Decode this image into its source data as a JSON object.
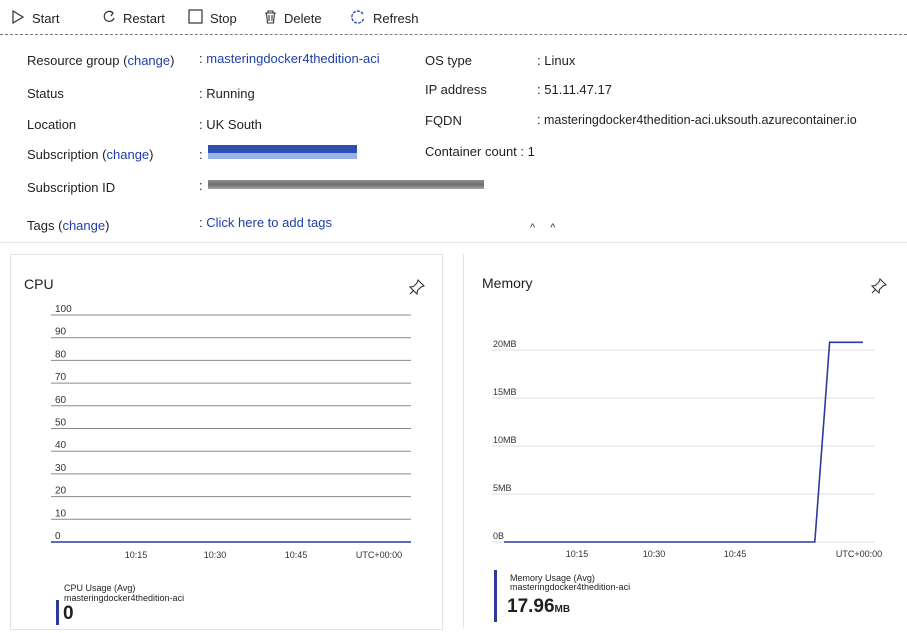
{
  "toolbar": {
    "start": "Start",
    "restart": "Restart",
    "stop": "Stop",
    "delete": "Delete",
    "refresh": "Refresh"
  },
  "essentials": {
    "resource_group_label": "Resource group",
    "change": "change",
    "resource_group_value": "masteringdocker4thedition-aci",
    "status_label": "Status",
    "status_value": "Running",
    "location_label": "Location",
    "location_value": "UK South",
    "subscription_label": "Subscription",
    "subscription_id_label": "Subscription ID",
    "tags_label": "Tags",
    "tags_value": "Click here to add tags",
    "os_type_label": "OS type",
    "os_type_value": "Linux",
    "ip_label": "IP address",
    "ip_value": "51.11.47.17",
    "fqdn_label": "FQDN",
    "fqdn_value": "masteringdocker4thedition-aci.uksouth.azurecontainer.io",
    "container_count_label": "Container count",
    "container_count_value": "1",
    "colon": ":",
    "open_paren": "(",
    "close_paren": ")"
  },
  "cpu_chart": {
    "title": "CPU",
    "legend_metric": "CPU Usage (Avg)",
    "legend_resource": "masteringdocker4thedition-aci",
    "current_value": "0",
    "current_unit": ""
  },
  "memory_chart": {
    "title": "Memory",
    "legend_metric": "Memory Usage (Avg)",
    "legend_resource": "masteringdocker4thedition-aci",
    "current_value": "17.96",
    "current_unit": "MB"
  },
  "colors": {
    "accent": "#1f3fa8",
    "series": "#2a3a9e"
  },
  "chart_data": [
    {
      "type": "line",
      "title": "CPU",
      "y_ticks": [
        "100",
        "90",
        "80",
        "70",
        "60",
        "50",
        "40",
        "30",
        "20",
        "10",
        "0"
      ],
      "x_ticks": [
        "10:15",
        "10:30",
        "10:45",
        "UTC+00:00"
      ],
      "ylim": [
        0,
        100
      ],
      "series": [
        {
          "name": "CPU Usage (Avg)",
          "x": [
            0,
            1
          ],
          "values": [
            0,
            0
          ]
        }
      ]
    },
    {
      "type": "line",
      "title": "Memory",
      "y_ticks": [
        "20MB",
        "15MB",
        "10MB",
        "5MB",
        "0B"
      ],
      "x_ticks": [
        "10:15",
        "10:30",
        "10:45",
        "UTC+00:00"
      ],
      "ylim": [
        0,
        20
      ],
      "series": [
        {
          "name": "Memory Usage (Avg)",
          "x": [
            0,
            0.84,
            0.87,
            0.88,
            0.97
          ],
          "values": [
            0,
            0,
            15.5,
            20.8,
            20.8
          ]
        }
      ]
    }
  ]
}
